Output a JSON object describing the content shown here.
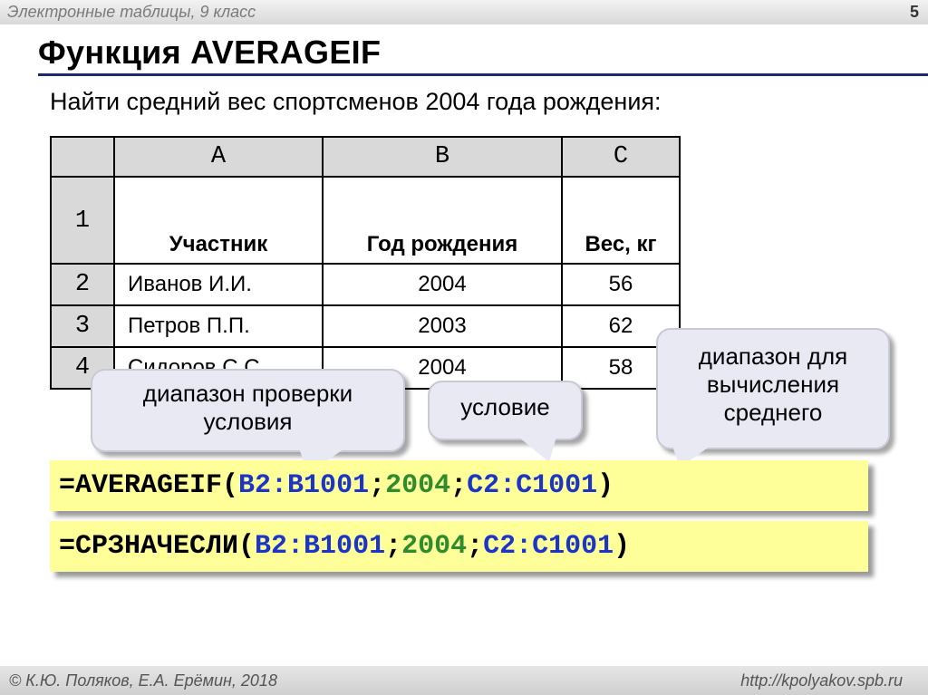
{
  "header": {
    "course": "Электронные таблицы, 9 класс",
    "slide_number": "5"
  },
  "title": "Функция AVERAGEIF",
  "task": "Найти средний вес спортсменов 2004 года рождения:",
  "sheet": {
    "columns": [
      "A",
      "B",
      "C"
    ],
    "rows": [
      {
        "num": "1",
        "a": "Участник",
        "b": "Год рождения",
        "c": "Вес, кг"
      },
      {
        "num": "2",
        "a": "Иванов И.И.",
        "b": "2004",
        "c": "56"
      },
      {
        "num": "3",
        "a": "Петров П.П.",
        "b": "2003",
        "c": "62"
      },
      {
        "num": "4",
        "a": "Сидоров С.С.",
        "b": "2004",
        "c": "58"
      }
    ]
  },
  "callouts": {
    "range": "диапазон проверки условия",
    "condition": "условие",
    "avg_range": "диапазон для вычисления среднего"
  },
  "formula_en": {
    "prefix": "=AVERAGEIF(",
    "arg1": "B2:B1001",
    "sep1": ";",
    "arg2": "2004",
    "sep2": ";",
    "arg3": "C2:C1001",
    "suffix": ")"
  },
  "formula_ru": {
    "prefix": "=СРЗНАЧЕСЛИ(",
    "arg1": "B2:B1001",
    "sep1": ";",
    "arg2": "2004",
    "sep2": ";",
    "arg3": "C2:C1001",
    "suffix": ")"
  },
  "footer": {
    "authors": "© К.Ю. Поляков, Е.А. Ерёмин, 2018",
    "url": "http://kpolyakov.spb.ru"
  },
  "colors": {
    "formula_bg": "#ffff99",
    "arg_range": "#1a35c8",
    "arg_criteria": "#2e8b2e",
    "title_rule": "#1f2a6e",
    "callout_bg": "#e9e9f3"
  }
}
